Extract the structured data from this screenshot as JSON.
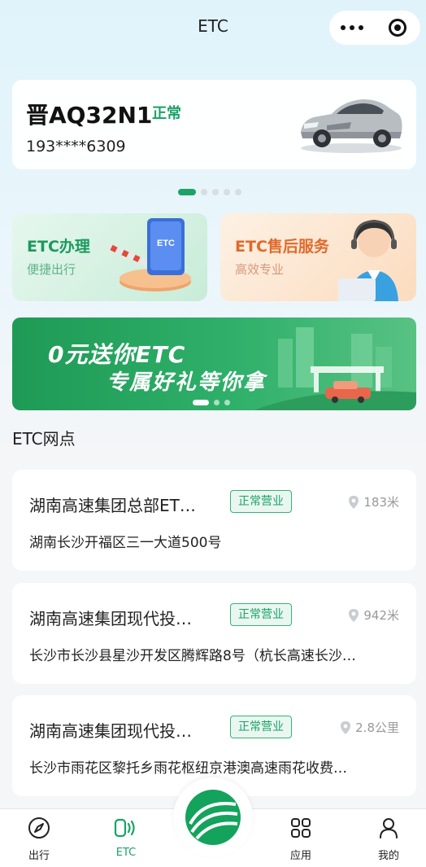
{
  "header": {
    "title": "ETC"
  },
  "vehicle": {
    "plate": "晋AQ32N1",
    "status": "正常",
    "phone": "193****6309"
  },
  "services": [
    {
      "title": "ETC办理",
      "subtitle": "便捷出行",
      "badge_text": "ETC"
    },
    {
      "title": "ETC售后服务",
      "subtitle": "高效专业"
    }
  ],
  "banner": {
    "line1": "0元送你ETC",
    "line2": "专属好礼等你拿"
  },
  "outlets_section": {
    "title": "ETC网点"
  },
  "outlets": [
    {
      "name": "湖南高速集团总部ET…",
      "badge": "正常营业",
      "distance": "183米",
      "address": "湖南长沙开福区三一大道500号"
    },
    {
      "name": "湖南高速集团现代投…",
      "badge": "正常营业",
      "distance": "942米",
      "address": "长沙市长沙县星沙开发区腾辉路8号（杭长高速长沙…"
    },
    {
      "name": "湖南高速集团现代投…",
      "badge": "正常营业",
      "distance": "2.8公里",
      "address": "长沙市雨花区黎托乡雨花枢纽京港澳高速雨花收费…"
    }
  ],
  "tabbar": {
    "items": [
      {
        "label": "出行",
        "icon": "compass-icon"
      },
      {
        "label": "ETC",
        "icon": "etc-signal-icon"
      },
      {
        "label": "应用",
        "icon": "grid-icon"
      },
      {
        "label": "我的",
        "icon": "person-icon"
      }
    ],
    "active": "ETC"
  },
  "colors": {
    "accent": "#1aa267",
    "orange": "#e06a2c",
    "banner": "#1e9a55"
  }
}
